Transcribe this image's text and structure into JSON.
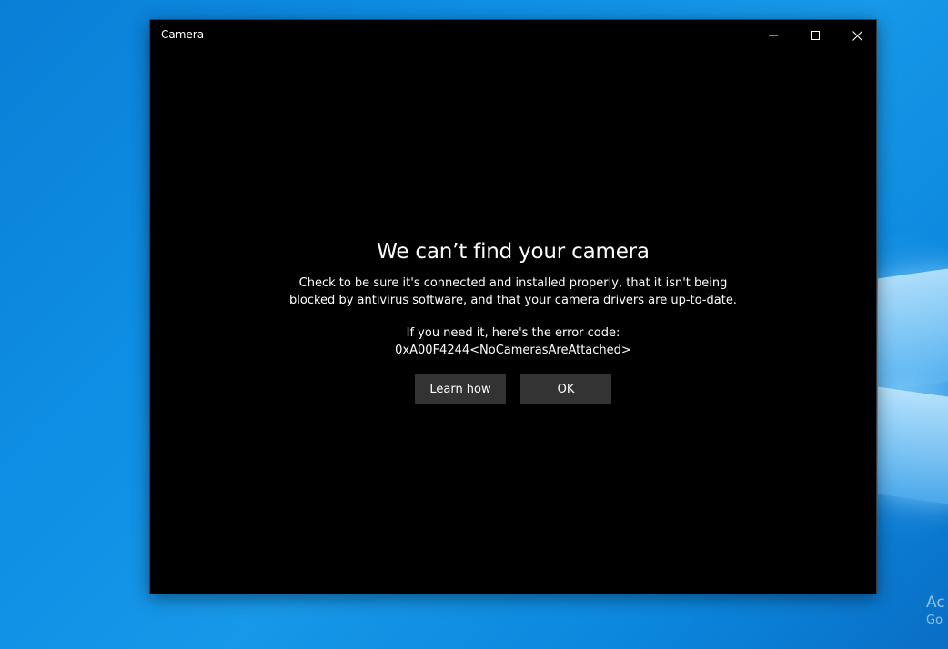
{
  "window": {
    "title": "Camera"
  },
  "dialog": {
    "heading": "We can’t find your camera",
    "description": "Check to be sure it's connected and installed properly, that it isn't being blocked by antivirus software, and that your camera drivers are up-to-date.",
    "error_label": "If you need it, here's the error code:",
    "error_code": "0xA00F4244<NoCamerasAreAttached>",
    "learn_how_label": "Learn how",
    "ok_label": "OK"
  },
  "desktop": {
    "watermark_line1": "Ac",
    "watermark_line2": "Go"
  },
  "icons": {
    "minimize": "minimize-icon",
    "maximize": "maximize-icon",
    "close": "close-icon"
  },
  "colors": {
    "window_bg": "#000000",
    "button_bg": "#333333",
    "desktop_blue": "#0e8ee4"
  }
}
